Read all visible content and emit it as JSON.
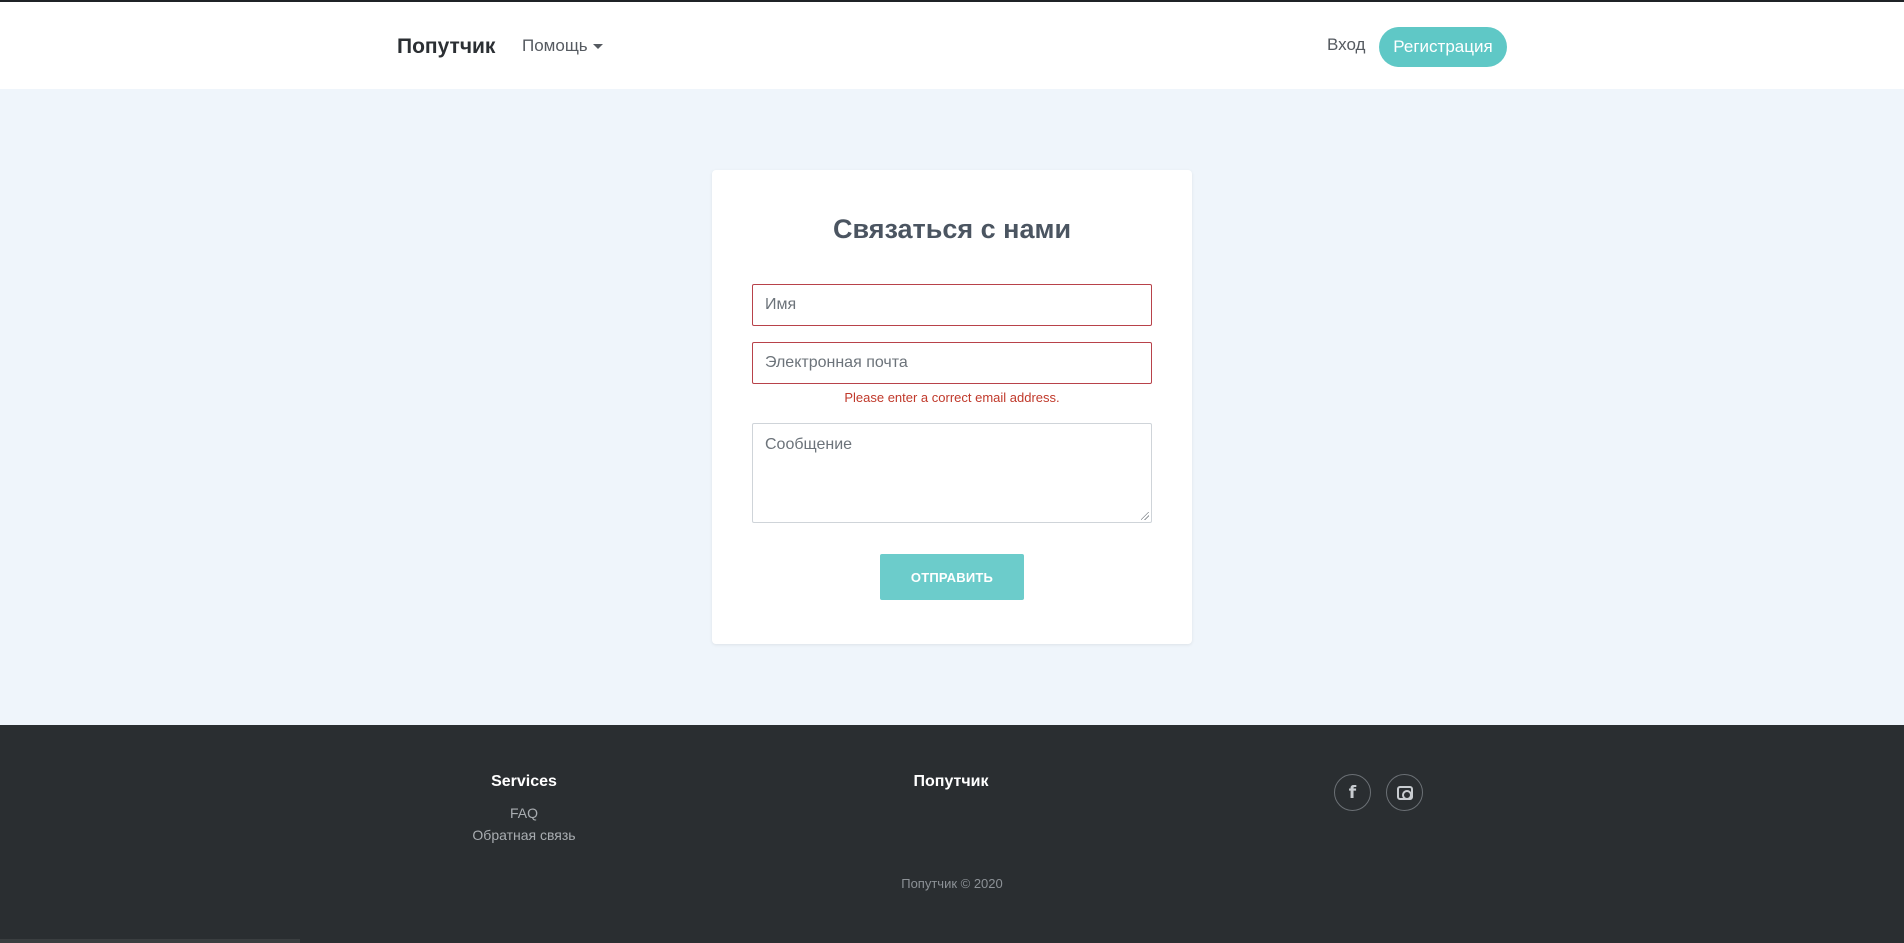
{
  "header": {
    "brand": "Попутчик",
    "help_label": "Помощь",
    "login_label": "Вход",
    "register_label": "Регистрация"
  },
  "contact_form": {
    "title": "Связаться с нами",
    "name_placeholder": "Имя",
    "email_placeholder": "Электронная почта",
    "email_error": "Please enter a correct email address.",
    "message_placeholder": "Сообщение",
    "submit_label": "ОТПРАВИТЬ"
  },
  "footer": {
    "services_heading": "Services",
    "services_links": [
      "FAQ",
      "Обратная связь"
    ],
    "brand_heading": "Попутчик",
    "social": [
      {
        "icon": "facebook-icon"
      },
      {
        "icon": "instagram-icon"
      }
    ],
    "copyright": "Попутчик © 2020"
  },
  "colors": {
    "accent": "#5fc8c6",
    "page_background": "#eff5fb",
    "footer_background": "#2a2e31",
    "error": "#b8424a"
  }
}
